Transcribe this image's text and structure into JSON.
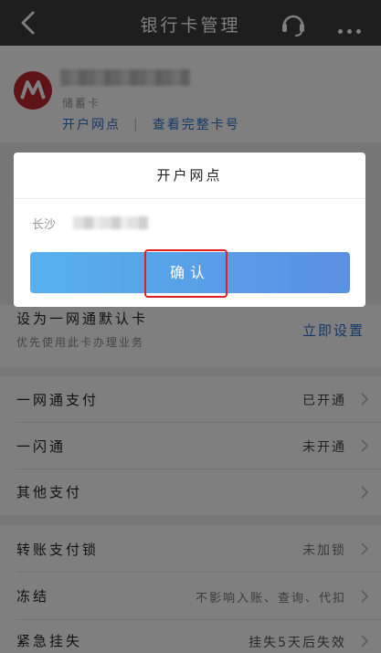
{
  "topbar": {
    "title": "银行卡管理"
  },
  "card": {
    "type": "储蓄卡",
    "link_branch": "开户网点",
    "link_full_number": "查看完整卡号",
    "logo_color": "#c0272d"
  },
  "default_row": {
    "label": "设为一网通默认卡",
    "sub": "优先使用此卡办理业务",
    "action": "立即设置"
  },
  "rows": [
    {
      "label": "一网通支付",
      "value": "已开通"
    },
    {
      "label": "一闪通",
      "value": "未开通"
    },
    {
      "label": "其他支付",
      "value": ""
    },
    {
      "label": "转账支付锁",
      "value": "未加锁"
    },
    {
      "label": "冻结",
      "value": "不影响入账、查询、代扣"
    },
    {
      "label": "紧急挂失",
      "value": "挂失5天后失效"
    }
  ],
  "modal": {
    "title": "开户网点",
    "branch_prefix": "长沙",
    "confirm_label": "确认"
  },
  "colors": {
    "topbar": "#3c3c3c",
    "link": "#2b73c9",
    "button_start": "#56b1ee",
    "button_end": "#5b8fe3",
    "highlight": "#e02020"
  }
}
